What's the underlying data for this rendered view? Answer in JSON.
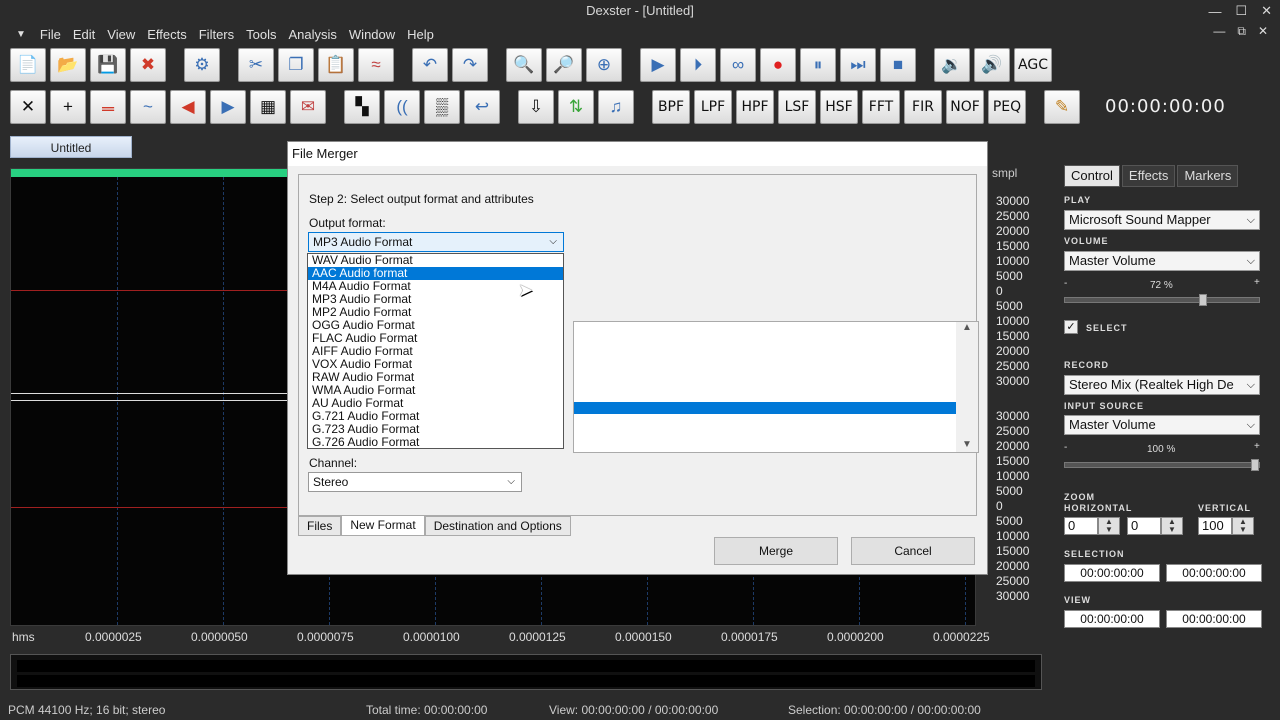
{
  "window": {
    "title": "Dexster - [Untitled]",
    "controls": [
      "—",
      "☐",
      "✕"
    ],
    "mdi_controls": [
      "—",
      "⧉",
      "✕"
    ]
  },
  "menu": [
    "File",
    "Edit",
    "View",
    "Effects",
    "Filters",
    "Tools",
    "Analysis",
    "Window",
    "Help"
  ],
  "toolbar1": [
    {
      "name": "new",
      "icon": "📄"
    },
    {
      "name": "open",
      "icon": "📂"
    },
    {
      "name": "save",
      "icon": "💾"
    },
    {
      "name": "close",
      "icon": "✖"
    },
    {
      "name": "settings",
      "icon": "⚙"
    },
    {
      "name": "cut",
      "icon": "✂"
    },
    {
      "name": "copy",
      "icon": "❐"
    },
    {
      "name": "paste",
      "icon": "📋"
    },
    {
      "name": "mix",
      "icon": "≈"
    },
    {
      "name": "undo",
      "icon": "↶"
    },
    {
      "name": "redo",
      "icon": "↷"
    },
    {
      "name": "zoom-in",
      "icon": "🔍"
    },
    {
      "name": "zoom-out",
      "icon": "🔎"
    },
    {
      "name": "zoom-full",
      "icon": "⊕"
    },
    {
      "name": "play",
      "icon": "▶"
    },
    {
      "name": "play-from",
      "icon": "⏵"
    },
    {
      "name": "loop",
      "icon": "∞"
    },
    {
      "name": "record",
      "icon": "●"
    },
    {
      "name": "pause",
      "icon": "⏸"
    },
    {
      "name": "forward",
      "icon": "⏭"
    },
    {
      "name": "stop",
      "icon": "■"
    },
    {
      "name": "speaker-left",
      "icon": "🔉"
    },
    {
      "name": "speaker-right",
      "icon": "🔊"
    }
  ],
  "agc_label": "AGC",
  "toolbar2_icons": [
    "✕",
    "+",
    "𝍡",
    "~",
    "◀",
    "▶",
    "▦",
    "✉",
    "▚",
    "((",
    "▒",
    "↩",
    "⇩",
    "⇅",
    "♫"
  ],
  "filters": [
    "BPF",
    "LPF",
    "HPF",
    "LSF",
    "HSF",
    "FFT",
    "FIR",
    "NOF",
    "PEQ"
  ],
  "edit_icon": "✎",
  "clock": "00:00:00:00",
  "file_tab": "Untitled",
  "scale": {
    "label": "smpl",
    "top": [
      "30000",
      "25000",
      "20000",
      "15000",
      "10000",
      "5000",
      "0",
      "5000",
      "10000",
      "15000",
      "20000",
      "25000",
      "30000"
    ],
    "bottom": [
      "30000",
      "25000",
      "20000",
      "15000",
      "10000",
      "5000",
      "0",
      "5000",
      "10000",
      "15000",
      "20000",
      "25000",
      "30000"
    ]
  },
  "timeline": [
    "hms",
    "0.0000025",
    "0.0000050",
    "0.0000075",
    "0.0000100",
    "0.0000125",
    "0.0000150",
    "0.0000175",
    "0.0000200",
    "0.0000225"
  ],
  "status": {
    "format": "PCM 44100 Hz; 16 bit; stereo",
    "total": "Total time: 00:00:00:00",
    "view": "View: 00:00:00:00 / 00:00:00:00",
    "selection": "Selection: 00:00:00:00 / 00:00:00:00"
  },
  "right_panel": {
    "tabs": [
      "Control",
      "Effects",
      "Markers"
    ],
    "play_label": "PLAY",
    "play_device": "Microsoft Sound Mapper",
    "volume_label": "VOLUME",
    "volume_device": "Master Volume",
    "volume_pct": "72 %",
    "volume_level": 0.72,
    "select_label": "SELECT",
    "record_label": "RECORD",
    "record_device": "Stereo Mix (Realtek High De",
    "input_label": "INPUT SOURCE",
    "input_device": "Master Volume",
    "input_pct": "100 %",
    "input_level": 1.0,
    "zoom_label": "ZOOM",
    "horizontal_label": "HORIZONTAL",
    "vertical_label": "VERTICAL",
    "zoom_h1": "0",
    "zoom_h2": "0",
    "zoom_v": "100",
    "selection_label": "SELECTION",
    "sel_start": "00:00:00:00",
    "sel_end": "00:00:00:00",
    "view_label": "VIEW",
    "view_start": "00:00:00:00",
    "view_end": "00:00:00:00"
  },
  "dialog": {
    "title": "File Merger",
    "step": "Step 2: Select output format and attributes",
    "output_label": "Output format:",
    "output_value": "MP3 Audio Format",
    "formats": [
      "WAV Audio Format",
      "AAC Audio format",
      "M4A Audio Format",
      "MP3 Audio Format",
      "MP2 Audio Format",
      "OGG Audio Format",
      "FLAC Audio Format",
      "AIFF Audio Format",
      "VOX Audio Format",
      "RAW Audio Format",
      "WMA Audio Format",
      "AU Audio Format",
      "G.721 Audio Format",
      "G.723 Audio Format",
      "G.726 Audio Format"
    ],
    "selected_index": 1,
    "channel_label": "Channel:",
    "channel_value": "Stereo",
    "tabs": [
      "Files",
      "New Format",
      "Destination and Options"
    ],
    "merge": "Merge",
    "cancel": "Cancel"
  }
}
